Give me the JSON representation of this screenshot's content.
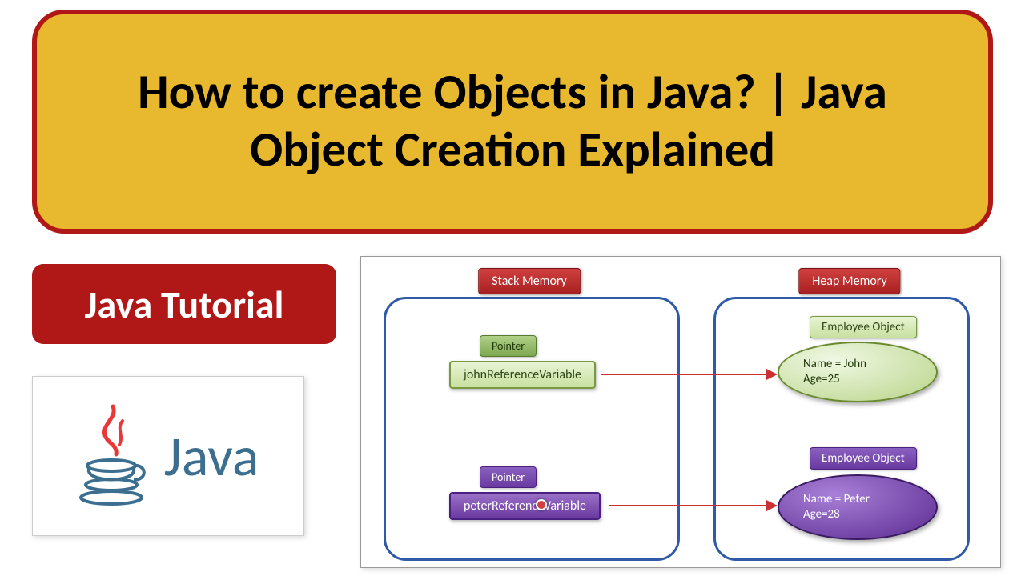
{
  "title": "How to create Objects in Java? | Java Object Creation Explained",
  "tutorial_label": "Java Tutorial",
  "logo_text": "Java",
  "diagram": {
    "stack_header": "Stack Memory",
    "heap_header": "Heap Memory",
    "pointer_label": "Pointer",
    "ref1": "johnReferenceVariable",
    "ref2": "peterReferenceVariable",
    "obj_label": "Employee Object",
    "obj1": {
      "line1": "Name = John",
      "line2": "Age=25"
    },
    "obj2": {
      "line1": "Name = Peter",
      "line2": "Age=28"
    }
  }
}
